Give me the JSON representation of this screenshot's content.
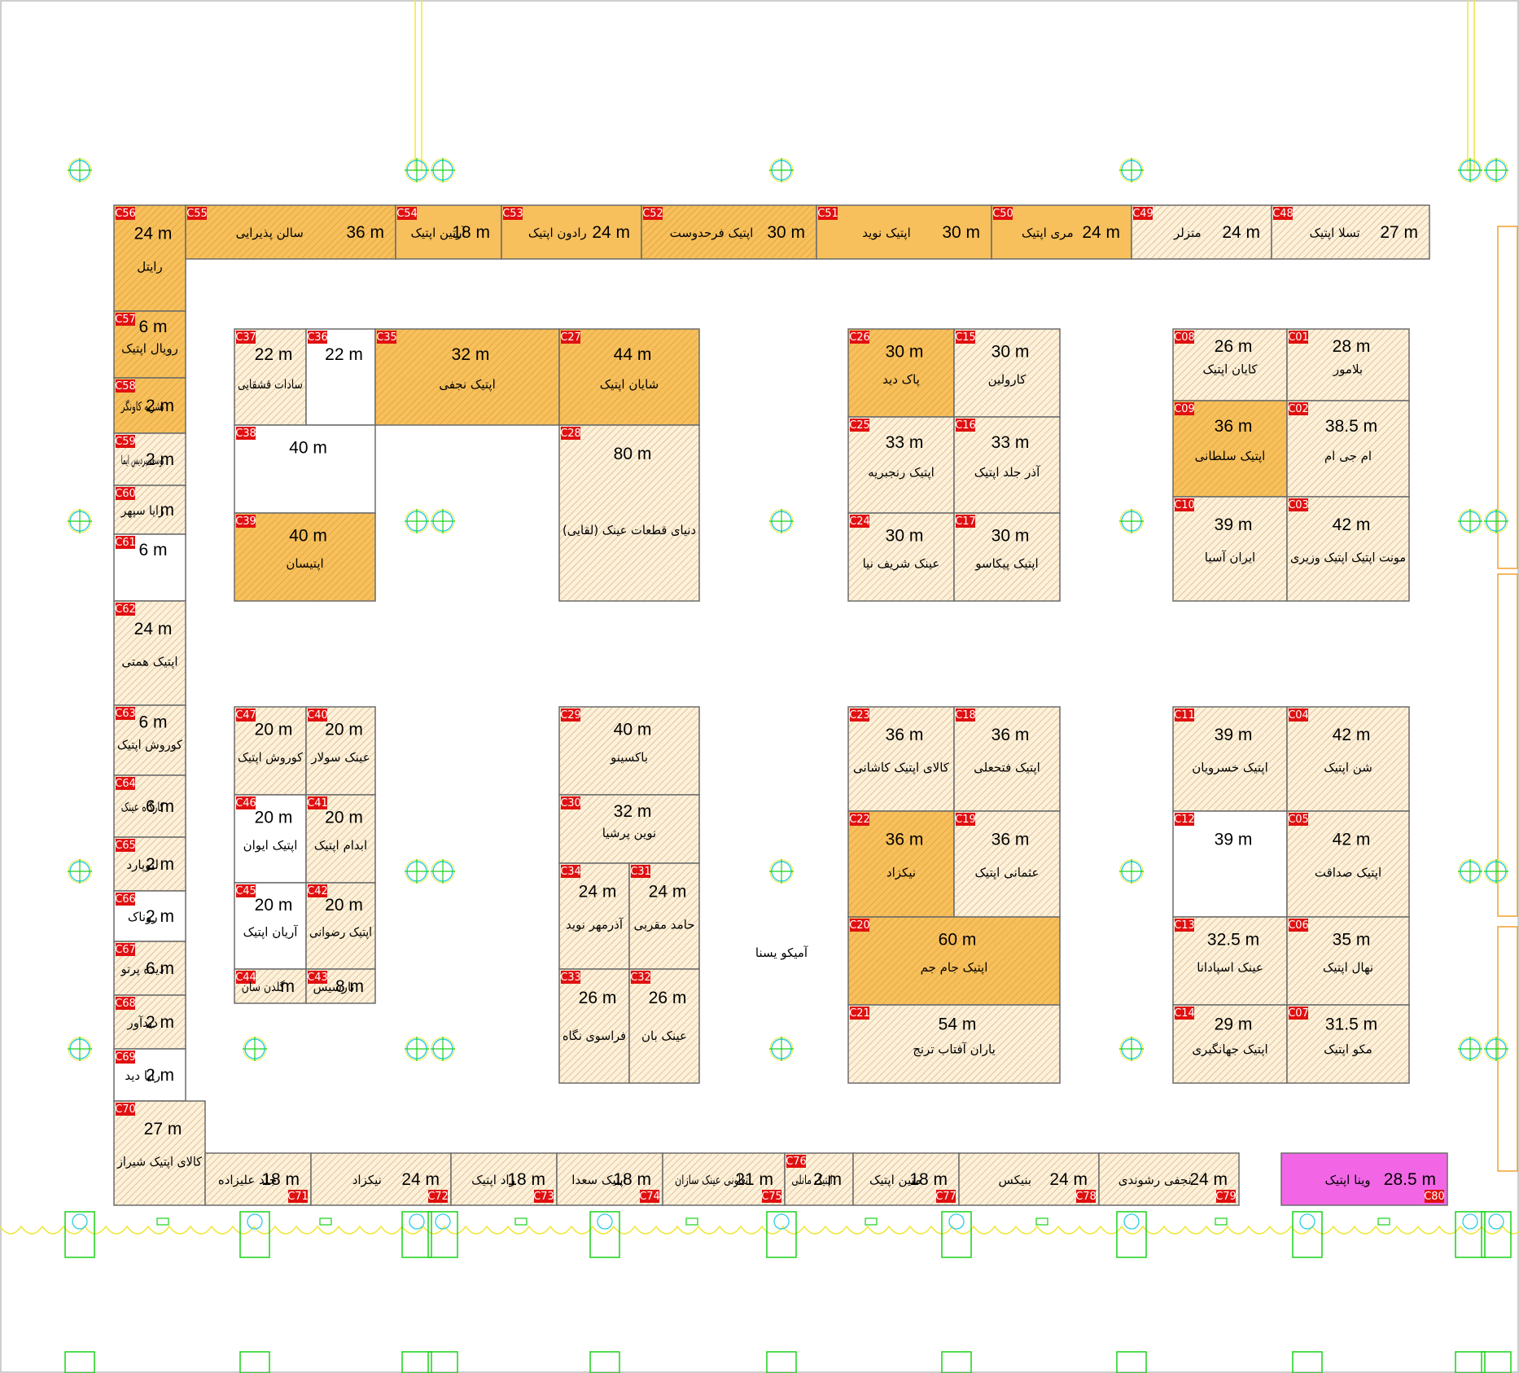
{
  "colors": {
    "orange": "#f7c05c",
    "hatch": "#e9c890",
    "white": "#ffffff",
    "pink": "#f266e6",
    "badge": "#e01010",
    "wall": "#6b6b6b",
    "grid": "#f0e73c",
    "green": "#19d219",
    "cyan": "#2ccde2"
  },
  "labels": {
    "center": "آمیکو یسنا"
  },
  "booths": [
    {
      "code": "C56",
      "area": "24 m",
      "name": "رایتل"
    },
    {
      "code": "C55",
      "area": "36 m",
      "name": "سالن پذیرایی"
    },
    {
      "code": "C54",
      "area": "18 m",
      "name": "آرتین اپتیک"
    },
    {
      "code": "C53",
      "area": "24 m",
      "name": "رادون اپتیک"
    },
    {
      "code": "C52",
      "area": "30 m",
      "name": "اپتیک فرحدوست"
    },
    {
      "code": "C51",
      "area": "30 m",
      "name": "اپتیک نوید"
    },
    {
      "code": "C50",
      "area": "24 m",
      "name": "مری اپتیک"
    },
    {
      "code": "C49",
      "area": "24 m",
      "name": "متزلر"
    },
    {
      "code": "C48",
      "area": "27 m",
      "name": "تسلا اپتیک"
    },
    {
      "code": "C57",
      "area": "6 m",
      "name": "رویال اپتیک"
    },
    {
      "code": "C58",
      "area": "2 m",
      "name": "نشریه کاونگر"
    },
    {
      "code": "C59",
      "area": "2 m",
      "name": "توسعه پردیس ایما"
    },
    {
      "code": "C60",
      "area": "m",
      "name": "رایا سپهر"
    },
    {
      "code": "C61",
      "area": "6 m",
      "name": ""
    },
    {
      "code": "C62",
      "area": "24 m",
      "name": "اپتیک همتی"
    },
    {
      "code": "C63",
      "area": "6 m",
      "name": "کوروش اپتیک"
    },
    {
      "code": "C64",
      "area": "6 m",
      "name": "کارگاه عینک"
    },
    {
      "code": "C65",
      "area": "2 m",
      "name": "لئوپارد"
    },
    {
      "code": "C66",
      "area": "2 m",
      "name": "روناک"
    },
    {
      "code": "C67",
      "area": "6 m",
      "name": "دیده پرتو"
    },
    {
      "code": "C68",
      "area": "2 m",
      "name": "دیدآور"
    },
    {
      "code": "C69",
      "area": "2 m",
      "name": "رایا دید"
    },
    {
      "code": "C70",
      "area": "27 m",
      "name": "کالای اپتیک شیراز"
    },
    {
      "code": "C71",
      "area": "18 m",
      "name": "جلد علیزاده"
    },
    {
      "code": "C72",
      "area": "24 m",
      "name": "نیکزاد"
    },
    {
      "code": "C73",
      "area": "18 m",
      "name": "راد اپتیک"
    },
    {
      "code": "C74",
      "area": "18 m",
      "name": "اپتیک سعدا"
    },
    {
      "code": "C75",
      "area": "21 m",
      "name": "تعاونی عینک سازان"
    },
    {
      "code": "C76",
      "area": "2 m",
      "name": "اپتیک مانلی"
    },
    {
      "code": "C77",
      "area": "18 m",
      "name": "متین اپتیک"
    },
    {
      "code": "C78",
      "area": "24 m",
      "name": "بنیکس"
    },
    {
      "code": "C79",
      "area": "24 m",
      "name": "نجفی رشوندی"
    },
    {
      "code": "C80",
      "area": "28.5 m",
      "name": "وینا اپتیک"
    },
    {
      "code": "C37",
      "area": "22 m",
      "name": "سادات قشقایی"
    },
    {
      "code": "C36",
      "area": "22 m",
      "name": ""
    },
    {
      "code": "C35",
      "area": "32 m",
      "name": "اپتیک نجفی"
    },
    {
      "code": "C27",
      "area": "44 m",
      "name": "شایان اپتیک"
    },
    {
      "code": "C38",
      "area": "40 m",
      "name": ""
    },
    {
      "code": "C39",
      "area": "40 m",
      "name": "اپتیسان"
    },
    {
      "code": "C28",
      "area": "80 m",
      "name": "دنیای قطعات عینک (لقایی)"
    },
    {
      "code": "C26",
      "area": "30 m",
      "name": "پاک دید"
    },
    {
      "code": "C15",
      "area": "30 m",
      "name": "کارولین"
    },
    {
      "code": "C25",
      "area": "33 m",
      "name": "اپتیک رنجبریه"
    },
    {
      "code": "C16",
      "area": "33 m",
      "name": "آذر جلد اپتیک"
    },
    {
      "code": "C24",
      "area": "30 m",
      "name": "عینک شریف نیا"
    },
    {
      "code": "C17",
      "area": "30 m",
      "name": "اپتیک پیکاسو"
    },
    {
      "code": "C08",
      "area": "26 m",
      "name": "کایان اپتیک"
    },
    {
      "code": "C01",
      "area": "28 m",
      "name": "بلامور"
    },
    {
      "code": "C09",
      "area": "36 m",
      "name": "اپتیک سلطانی"
    },
    {
      "code": "C02",
      "area": "38.5 m",
      "name": "ام جی ام"
    },
    {
      "code": "C10",
      "area": "39 m",
      "name": "ایران آسیا"
    },
    {
      "code": "C03",
      "area": "42 m",
      "name": "مونت اپتیک اپتیک وزیری"
    },
    {
      "code": "C47",
      "area": "20 m",
      "name": "کوروش اپتیک"
    },
    {
      "code": "C40",
      "area": "20 m",
      "name": "عینک سولار"
    },
    {
      "code": "C46",
      "area": "20 m",
      "name": "اپتیک ایوان"
    },
    {
      "code": "C41",
      "area": "20 m",
      "name": "ابدام اپتیک"
    },
    {
      "code": "C45",
      "area": "20 m",
      "name": "آریان اپتیک"
    },
    {
      "code": "C42",
      "area": "20 m",
      "name": "اپتیک رضوانی"
    },
    {
      "code": "C44",
      "area": "m",
      "name": "گلدن سان"
    },
    {
      "code": "C43",
      "area": "8 m",
      "name": "نارسیس"
    },
    {
      "code": "C29",
      "area": "40 m",
      "name": "باکسینو"
    },
    {
      "code": "C30",
      "area": "32 m",
      "name": "نوین پرشیا"
    },
    {
      "code": "C34",
      "area": "24 m",
      "name": "آذرمهر نوید"
    },
    {
      "code": "C31",
      "area": "24 m",
      "name": "حامد مقربی"
    },
    {
      "code": "C33",
      "area": "26 m",
      "name": "فراسوی نگاه"
    },
    {
      "code": "C32",
      "area": "26 m",
      "name": "عینک بان"
    },
    {
      "code": "C23",
      "area": "36 m",
      "name": "کالای اپتیک کاشانی"
    },
    {
      "code": "C18",
      "area": "36 m",
      "name": "اپتیک فتحعلی"
    },
    {
      "code": "C22",
      "area": "36 m",
      "name": "نیکزاد"
    },
    {
      "code": "C19",
      "area": "36 m",
      "name": "عثمانی اپتیک"
    },
    {
      "code": "C20",
      "area": "60 m",
      "name": "اپتیک جام جم"
    },
    {
      "code": "C21",
      "area": "54 m",
      "name": "یاران آفتاب ترنج"
    },
    {
      "code": "C11",
      "area": "39 m",
      "name": "اپتیک خسرویان"
    },
    {
      "code": "C04",
      "area": "42 m",
      "name": "شن اپتیک"
    },
    {
      "code": "C12",
      "area": "39 m",
      "name": ""
    },
    {
      "code": "C05",
      "area": "42 m",
      "name": "اپتیک صداقت"
    },
    {
      "code": "C13",
      "area": "32.5 m",
      "name": "عینک اسپادانا"
    },
    {
      "code": "C06",
      "area": "35 m",
      "name": "نهال اپتیک"
    },
    {
      "code": "C14",
      "area": "29 m",
      "name": "اپتیک جهانگیری"
    },
    {
      "code": "C07",
      "area": "31.5 m",
      "name": "مکو اپتیک"
    }
  ]
}
